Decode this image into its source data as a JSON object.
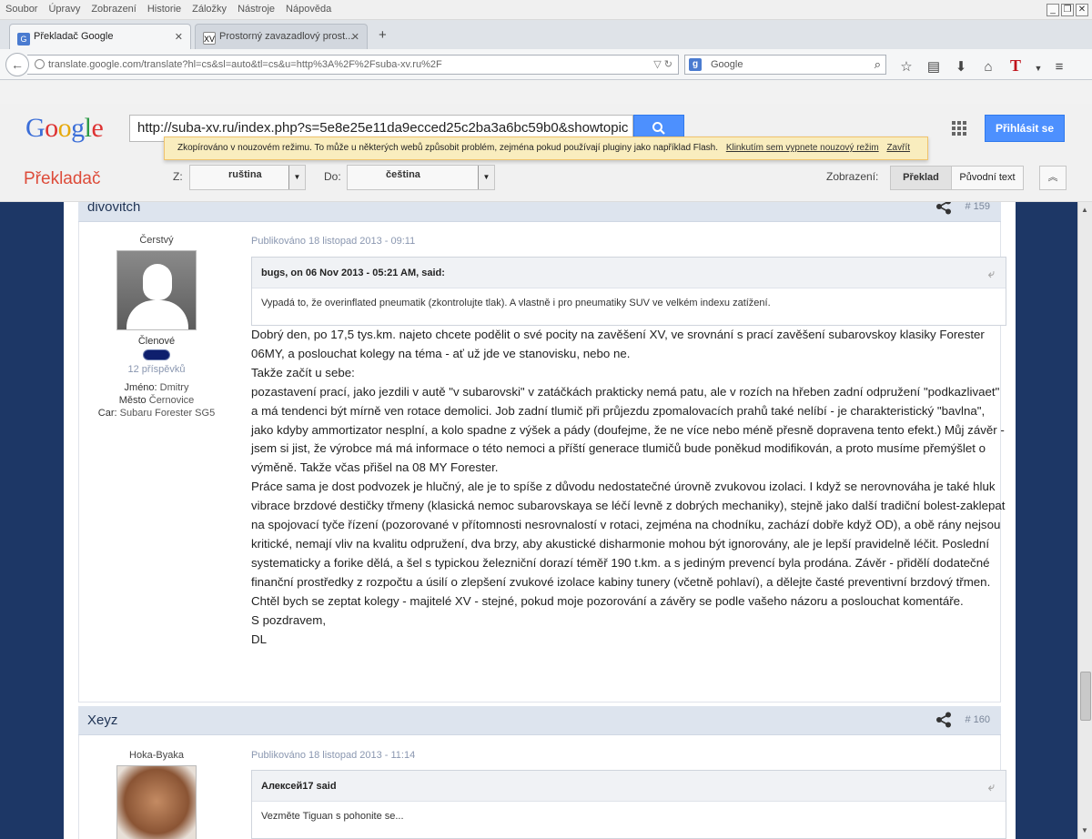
{
  "menu": [
    "Soubor",
    "Úpravy",
    "Zobrazení",
    "Historie",
    "Záložky",
    "Nástroje",
    "Nápověda"
  ],
  "tabs": [
    {
      "title": "Překladač Google",
      "icon": "google-translate-icon"
    },
    {
      "title": "Prostorný zavazadlový prost...",
      "icon": "xv-favicon"
    }
  ],
  "address": "translate.google.com/translate?hl=cs&sl=auto&tl=cs&u=http%3A%2F%2Fsuba-xv.ru%2F",
  "search_placeholder": "Google",
  "gt": {
    "url_value": "http://suba-xv.ru/index.php?s=5e8e25e11da9ecced25c2ba3a6bc59b0&showtopic",
    "signin": "Přihlásit se",
    "notice_text": "Zkopírováno v nouzovém režimu. To může u některých webů způsobit problém, zejména pokud používají pluginy jako například Flash.",
    "notice_link": "Klinkutím sem vypnete nouzový režim",
    "notice_close": "Zavřít",
    "title": "Překladač",
    "from_label": "Z:",
    "from_lang": "ruština",
    "to_label": "Do:",
    "to_lang": "čeština",
    "view_label": "Zobrazení:",
    "view_translated": "Překlad",
    "view_original": "Původní text"
  },
  "post1": {
    "author": "divovitch",
    "number": "# 159",
    "rank": "Čerstvý",
    "group": "Členové",
    "posts": "12 příspěvků",
    "name_label": "Jméno:",
    "name": "Dmitry",
    "city_label": "Město",
    "city": "Černovice",
    "car_label": "Car:",
    "car": "Subaru Forester SG5",
    "published": "Publikováno 18 listopad 2013 - 09:11",
    "quote_head": "bugs, on 06 Nov 2013 - 05:21 AM, said:",
    "quote_body": "Vypadá to, že overinflated pneumatik (zkontrolujte tlak). A vlastně i pro pneumatiky SUV ve velkém indexu zatížení.",
    "lines": [
      "Dobrý den, po 17,5 tys.km. najeto chcete podělit o své pocity na zavěšení XV, ve srovnání s prací zavěšení subarovskoy klasiky Forester",
      "06MY, a poslouchat kolegy na téma - ať už jde ve stanovisku, nebo ne.",
      "Takže začít u sebe:",
      "pozastavení prací, jako jezdili v autě \"v subarovski\" v zatáčkách prakticky nemá patu, ale v rozích na hřeben zadní odpružení \"podkazlivaet\"",
      "a má tendenci být mírně ven rotace demolici. Job zadní tlumič při průjezdu zpomalovacích prahů také nelíbí - je charakteristický \"bavlna\",",
      "jako kdyby ammortizator nesplní, a kolo spadne z výšek a pády (doufejme, že ne více nebo méně přesně dopravena tento efekt.) Můj závěr -",
      "jsem si jist, že výrobce má má informace o této nemoci a příští generace tlumičů bude poněkud modifikován, a proto musíme přemýšlet o",
      "výměně. Takže včas přišel na 08 MY Forester.",
      "Práce sama je dost podvozek je hlučný, ale je to spíše z důvodu nedostatečné úrovně zvukovou izolaci. I když se nerovnováha je také hluk",
      "vibrace brzdové destičky třmeny (klasická nemoc subarovskaya se léčí levně z dobrých mechaniky), stejně jako další tradiční bolest-zaklepat",
      "na spojovací tyče řízení (pozorované v přítomnosti nesrovnalostí v rotaci, zejména na chodníku, zachází dobře když OD), a obě rány nejsou",
      "kritické, nemají vliv na kvalitu odpružení, dva brzy, aby akustické disharmonie mohou být ignorovány, ale je lepší pravidelně léčit. Poslední",
      "systematicky a forike dělá, a šel s typickou železniční dorazí téměř 190 t.km. a s jediným prevencí byla prodána. Závěr - přidělí dodatečné",
      "finanční prostředky z rozpočtu a úsilí o zlepšení zvukové izolace kabiny tunery (včetně pohlaví), a dělejte časté preventivní brzdový třmen.",
      "Chtěl bych se zeptat kolegy - majitelé XV - stejné, pokud moje pozorování a závěry se podle vašeho názoru a poslouchat komentáře.",
      "S pozdravem,",
      "DL"
    ]
  },
  "post2": {
    "author": "Xeyz",
    "number": "# 160",
    "rank": "Hoka-Byaka",
    "published": "Publikováno 18 listopad 2013 - 11:14",
    "quote_head": "Алексей17 said",
    "quote_body": "Vezměte Tiguan s pohonite se..."
  },
  "colors": {
    "google_blue": "#4d90fe",
    "notice_bg": "#f9edbe",
    "translator_red": "#dd4b39",
    "forum_bg": "#2b4a80",
    "post_header_bg": "#dde4ee"
  }
}
